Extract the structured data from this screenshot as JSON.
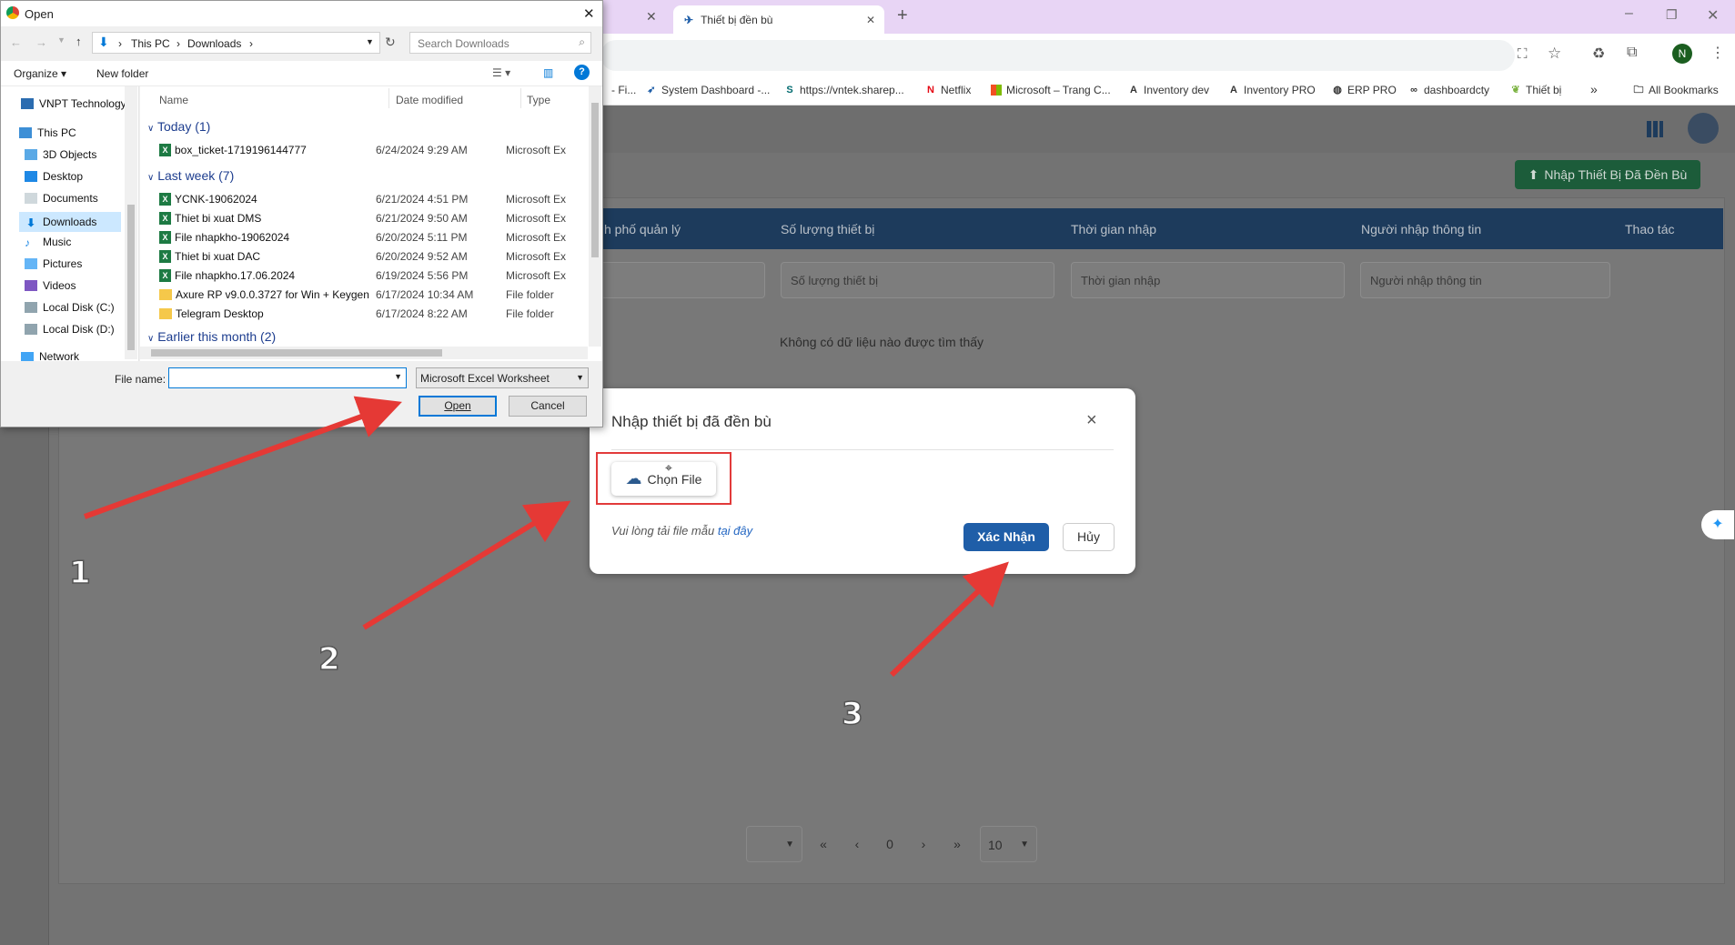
{
  "browser": {
    "tab_active": "Thiết bị đền bù",
    "bookmarks": [
      "- Fi...",
      "System Dashboard -...",
      "https://vntek.sharep...",
      "Netflix",
      "Microsoft – Trang C...",
      "Inventory dev",
      "Inventory PRO",
      "ERP PRO",
      "dashboardcty",
      "Thiết bị"
    ],
    "all_bookmarks": "All Bookmarks",
    "profile_initial": "N",
    "more": "»"
  },
  "app": {
    "import_button": "Nhập Thiết Bị Đã Đền Bù",
    "columns": [
      "h phố quản lý",
      "Số lượng thiết bị",
      "Thời gian nhập",
      "Người nhập thông tin",
      "Thao tác"
    ],
    "filters": [
      "Số lượng thiết bị",
      "Thời gian nhập",
      "Người nhập thông tin"
    ],
    "no_data": "Không có dữ liệu nào được tìm thấy",
    "pagination": {
      "first": "«",
      "prev": "‹",
      "page": "0",
      "next": "›",
      "last": "»",
      "page_size": "10"
    }
  },
  "modal": {
    "title": "Nhập thiết bị đã đền bù",
    "close": "×",
    "choose_file": "Chọn File",
    "hint": "Vui lòng tải file mẫu ",
    "hint_link": "tại đây",
    "confirm": "Xác Nhận",
    "cancel": "Hủy"
  },
  "dialog": {
    "title": "Open",
    "close": "✕",
    "path": [
      "This PC",
      "Downloads"
    ],
    "search_placeholder": "Search Downloads",
    "organize": "Organize ▾",
    "new_folder": "New folder",
    "nav": [
      "VNPT Technology",
      "This PC",
      "3D Objects",
      "Desktop",
      "Documents",
      "Downloads",
      "Music",
      "Pictures",
      "Videos",
      "Local Disk (C:)",
      "Local Disk (D:)",
      "Network"
    ],
    "columns": {
      "name": "Name",
      "date": "Date modified",
      "type": "Type"
    },
    "groups": {
      "today": "Today (1)",
      "last_week": "Last week (7)",
      "earlier": "Earlier this month (2)"
    },
    "files_today": [
      {
        "name": "box_ticket-1719196144777",
        "date": "6/24/2024 9:29 AM",
        "type": "Microsoft Ex"
      }
    ],
    "files_week": [
      {
        "name": "YCNK-19062024",
        "date": "6/21/2024 4:51 PM",
        "type": "Microsoft Ex"
      },
      {
        "name": "Thiet bi xuat DMS",
        "date": "6/21/2024 9:50 AM",
        "type": "Microsoft Ex"
      },
      {
        "name": "File nhapkho-19062024",
        "date": "6/20/2024 5:11 PM",
        "type": "Microsoft Ex"
      },
      {
        "name": "Thiet bi xuat DAC",
        "date": "6/20/2024 9:52 AM",
        "type": "Microsoft Ex"
      },
      {
        "name": "File nhapkho.17.06.2024",
        "date": "6/19/2024 5:56 PM",
        "type": "Microsoft Ex"
      },
      {
        "name": "Axure RP v9.0.0.3727 for Win + Keygen",
        "date": "6/17/2024 10:34 AM",
        "type": "File folder"
      },
      {
        "name": "Telegram Desktop",
        "date": "6/17/2024 8:22 AM",
        "type": "File folder"
      }
    ],
    "file_name_label": "File name:",
    "file_name_value": "",
    "file_type": "Microsoft Excel Worksheet",
    "open": "Open",
    "cancel": "Cancel"
  },
  "annotations": [
    "1",
    "2",
    "3"
  ],
  "colors": {
    "arrow": "#e53935",
    "primary": "#1f5ea8",
    "header": "#1d3b5c"
  }
}
